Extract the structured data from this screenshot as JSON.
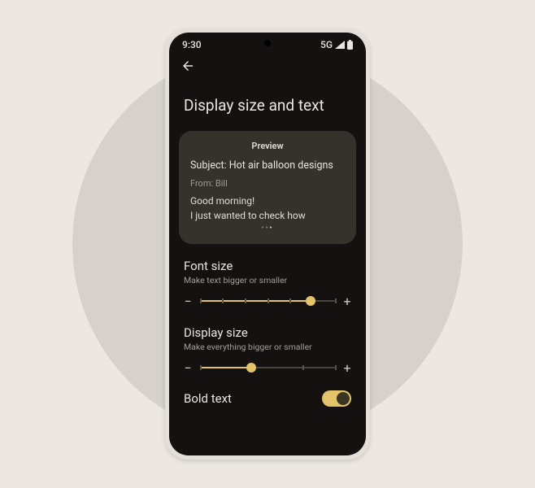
{
  "status": {
    "time": "9:30",
    "network": "5G"
  },
  "page": {
    "title": "Display size and text"
  },
  "preview": {
    "label": "Preview",
    "subject": "Subject: Hot air balloon designs",
    "from": "From: Bill",
    "line1": "Good morning!",
    "line2": "I just wanted to check how"
  },
  "font": {
    "title": "Font size",
    "sub": "Make text bigger or smaller",
    "minus": "−",
    "plus": "+"
  },
  "display": {
    "title": "Display size",
    "sub": "Make everything bigger or smaller",
    "minus": "−",
    "plus": "+"
  },
  "bold": {
    "label": "Bold text"
  }
}
